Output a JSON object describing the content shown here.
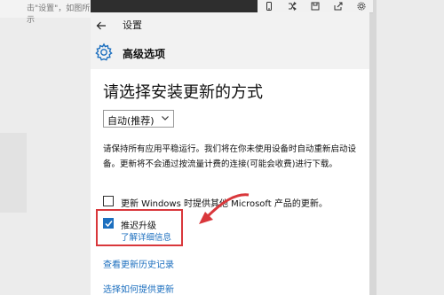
{
  "background": {
    "left_text": "击\"设置\"，如图所示"
  },
  "toolbar": {
    "icons": [
      "phone-icon",
      "shuffle-icon",
      "save-icon",
      "share-icon",
      "gear-icon"
    ]
  },
  "window": {
    "title": "设置",
    "header_title": "高级选项",
    "heading": "请选择安装更新的方式",
    "dropdown_value": "自动(推荐)",
    "description": "请保持所有应用平稳运行。我们将在你未使用设备时自动重新启动设备。更新将不会通过按流量计费的连接(可能会收费)进行下载。",
    "checkbox_other_products": {
      "label": "更新 Windows 时提供其他 Microsoft 产品的更新。",
      "checked": false
    },
    "checkbox_defer": {
      "label": "推迟升级",
      "checked": true
    },
    "learn_more": "了解详细信息",
    "link_history": "查看更新历史记录",
    "link_choose": "选择如何提供更新"
  },
  "colors": {
    "accent": "#1c6fbf",
    "highlight": "#d9373b"
  }
}
